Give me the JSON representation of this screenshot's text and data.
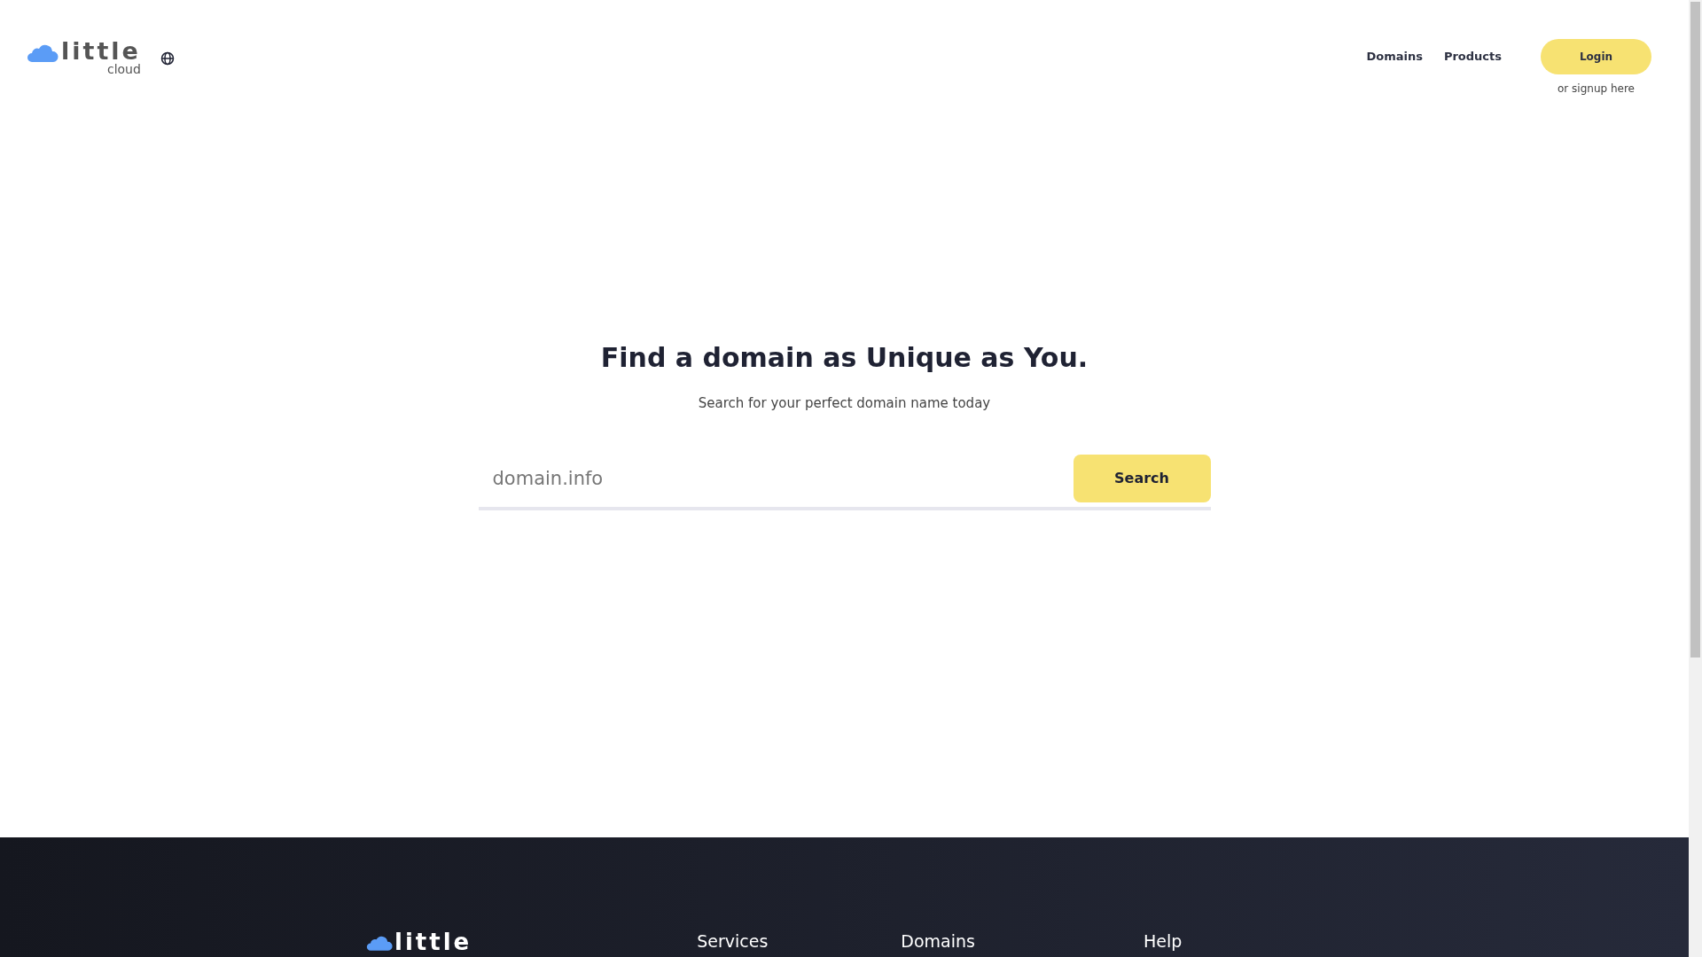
{
  "header": {
    "logo": {
      "word": "little",
      "subword": "cloud"
    },
    "nav": [
      "Domains",
      "Products"
    ],
    "login": "Login",
    "signup": "or signup here"
  },
  "hero": {
    "title": "Find a domain as Unique as You.",
    "subtitle": "Search for your perfect domain name today",
    "search": {
      "placeholder": "domain.info",
      "button": "Search"
    }
  },
  "footer": {
    "logo": "little",
    "columns": [
      "Services",
      "Domains",
      "Help"
    ]
  }
}
